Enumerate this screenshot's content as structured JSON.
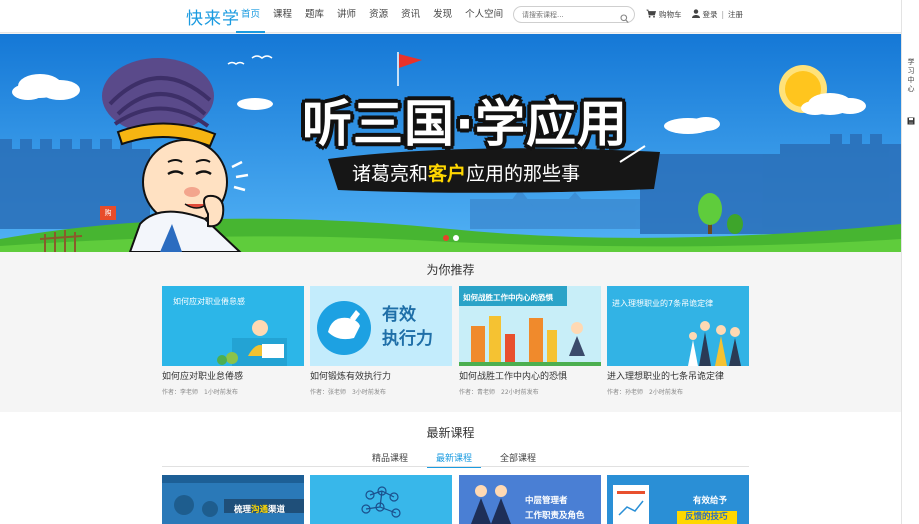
{
  "header": {
    "logo": "快来学",
    "nav": [
      "首页",
      "课程",
      "题库",
      "讲师",
      "资源",
      "资讯",
      "发现",
      "个人空间"
    ],
    "search_placeholder": "请搜索课程...",
    "cart": "购物车",
    "login": "登录",
    "divider": "|",
    "register": "注册"
  },
  "rail": {
    "label": "学习中心"
  },
  "banner": {
    "headline": "听三国·学应用",
    "sub_before": "诸葛亮和",
    "sub_highlight": "客户",
    "sub_after": "应用的那些事",
    "badge": "购"
  },
  "recommend": {
    "title": "为你推荐",
    "cards": [
      {
        "thumb_caption": "如何应对职业倦怠感",
        "title": "如何应对职业怠倦感",
        "author": "作者：李老师",
        "time": "1小时前发布"
      },
      {
        "thumb_caption_1": "有效",
        "thumb_caption_2": "执行力",
        "title": "如何锻炼有效执行力",
        "author": "作者：张老师",
        "time": "3小时前发布"
      },
      {
        "thumb_caption": "如何战胜工作中内心的恐惧",
        "title": "如何战胜工作中内心的恐惧",
        "author": "作者：青老师",
        "time": "22小时前发布"
      },
      {
        "thumb_caption": "进入理想职业的7条吊诡定律",
        "title": "进入理想职业的七条吊诡定律",
        "author": "作者：孙老师",
        "time": "2小时前发布"
      }
    ]
  },
  "latest": {
    "title": "最新课程",
    "tabs": [
      "精品课程",
      "最新课程",
      "全部课程"
    ],
    "cards": [
      {
        "caption_a": "梳理",
        "caption_b": "沟通",
        "caption_c": "渠道"
      },
      {
        "caption": ""
      },
      {
        "caption_1": "中层管理者",
        "caption_2": "工作职责及角色"
      },
      {
        "caption_1": "有效给予",
        "caption_2": "反馈的技巧"
      }
    ]
  }
}
